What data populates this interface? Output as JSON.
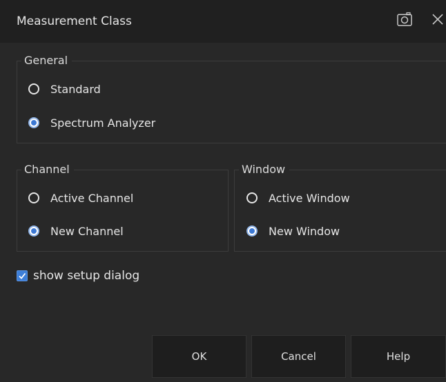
{
  "dialog": {
    "title": "Measurement Class"
  },
  "general": {
    "title": "General",
    "options": [
      {
        "label": "Standard",
        "selected": false
      },
      {
        "label": "Spectrum Analyzer",
        "selected": true
      }
    ]
  },
  "channel": {
    "title": "Channel",
    "options": [
      {
        "label": "Active Channel",
        "selected": false
      },
      {
        "label": "New Channel",
        "selected": true
      }
    ]
  },
  "window": {
    "title": "Window",
    "options": [
      {
        "label": "Active Window",
        "selected": false
      },
      {
        "label": "New Window",
        "selected": true
      }
    ]
  },
  "setup_dialog": {
    "label": "show setup dialog",
    "checked": true
  },
  "buttons": {
    "ok": "OK",
    "cancel": "Cancel",
    "help": "Help"
  },
  "icons": {
    "camera": "camera-icon",
    "close": "close-icon"
  },
  "colors": {
    "accent": "#3b78d4",
    "background": "#282828",
    "titlebar": "#202020",
    "button": "#1e1e1e"
  }
}
